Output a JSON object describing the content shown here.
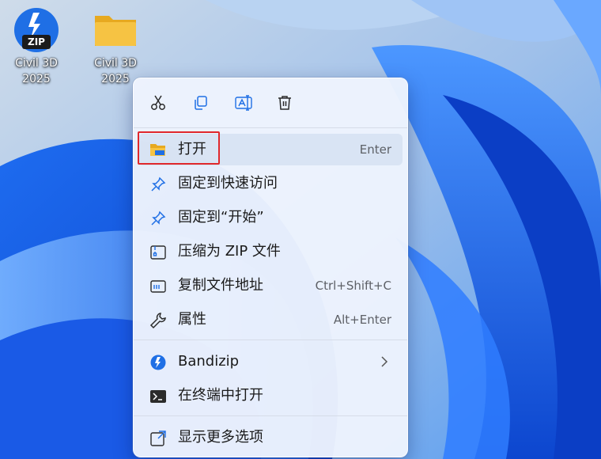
{
  "desktop": {
    "icons": [
      {
        "label_line1": "Civil 3D",
        "label_line2": "2025",
        "icon": "bandizip-zip-icon",
        "badge": "ZIP"
      },
      {
        "label_line1": "Civil 3D",
        "label_line2": "2025",
        "icon": "folder-icon"
      }
    ]
  },
  "context_menu": {
    "toolbar": [
      {
        "name": "cut",
        "icon": "scissors-icon"
      },
      {
        "name": "copy",
        "icon": "copy-icon"
      },
      {
        "name": "rename",
        "icon": "rename-icon"
      },
      {
        "name": "delete",
        "icon": "trash-icon"
      }
    ],
    "items": [
      {
        "label": "打开",
        "shortcut": "Enter",
        "icon": "folder-open-icon",
        "highlighted": true
      },
      {
        "label": "固定到快速访问",
        "shortcut": "",
        "icon": "pin-icon"
      },
      {
        "label": "固定到“开始”",
        "shortcut": "",
        "icon": "pin-icon"
      },
      {
        "label": "压缩为 ZIP 文件",
        "shortcut": "",
        "icon": "zip-file-icon"
      },
      {
        "label": "复制文件地址",
        "shortcut": "Ctrl+Shift+C",
        "icon": "copy-path-icon"
      },
      {
        "label": "属性",
        "shortcut": "Alt+Enter",
        "icon": "wrench-icon"
      },
      {
        "label": "Bandizip",
        "shortcut": "",
        "icon": "bandizip-icon",
        "submenu": true
      },
      {
        "label": "在终端中打开",
        "shortcut": "",
        "icon": "terminal-icon"
      },
      {
        "label": "显示更多选项",
        "shortcut": "",
        "icon": "show-more-icon"
      }
    ]
  },
  "colors": {
    "accent_blue": "#1f6fe5",
    "highlight_red": "#e0282c",
    "folder_yellow": "#f6c343"
  }
}
